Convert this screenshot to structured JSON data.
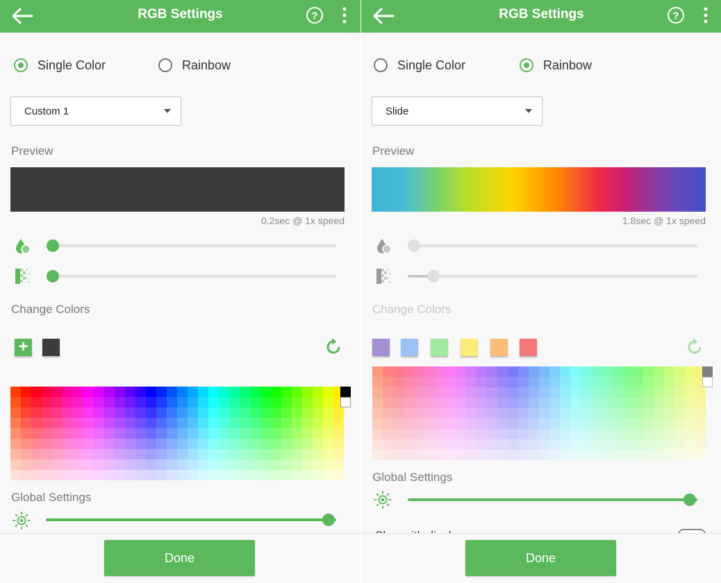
{
  "colors": {
    "accent": "#5cb85c",
    "preview_dark": "#3c3c3c"
  },
  "icons": [
    "back-arrow-icon",
    "help-icon",
    "more-vert-icon",
    "speed-drop-icon",
    "fade-pattern-icon",
    "add-icon",
    "reset-icon",
    "brightness-icon"
  ],
  "left": {
    "title": "RGB Settings",
    "radio_single": "Single Color",
    "radio_rainbow": "Rainbow",
    "selected_mode": "single",
    "dropdown_value": "Custom 1",
    "preview_label": "Preview",
    "preview_note": "0.2sec @ 1x speed",
    "change_colors_label": "Change Colors",
    "custom_colors": [
      "#3c3c3c"
    ],
    "speed_level": 0,
    "fade_level": 0,
    "global_settings_label": "Global Settings",
    "brightness_level": 1.0,
    "done_label": "Done"
  },
  "right": {
    "title": "RGB Settings",
    "radio_single": "Single Color",
    "radio_rainbow": "Rainbow",
    "selected_mode": "rainbow",
    "dropdown_value": "Slide",
    "preview_label": "Preview",
    "preview_note": "1.8sec @ 1x speed",
    "change_colors_label": "Change Colors",
    "rainbow_colors": [
      "#a48fd0",
      "#9dc3f5",
      "#a3e8a1",
      "#fbeb77",
      "#fbbd78",
      "#f27877"
    ],
    "speed_level": 0,
    "fade_level": 0.1,
    "global_settings_label": "Global Settings",
    "brightness_level": 1.0,
    "partial_row_label": "Sh... with display",
    "done_label": "Done"
  }
}
